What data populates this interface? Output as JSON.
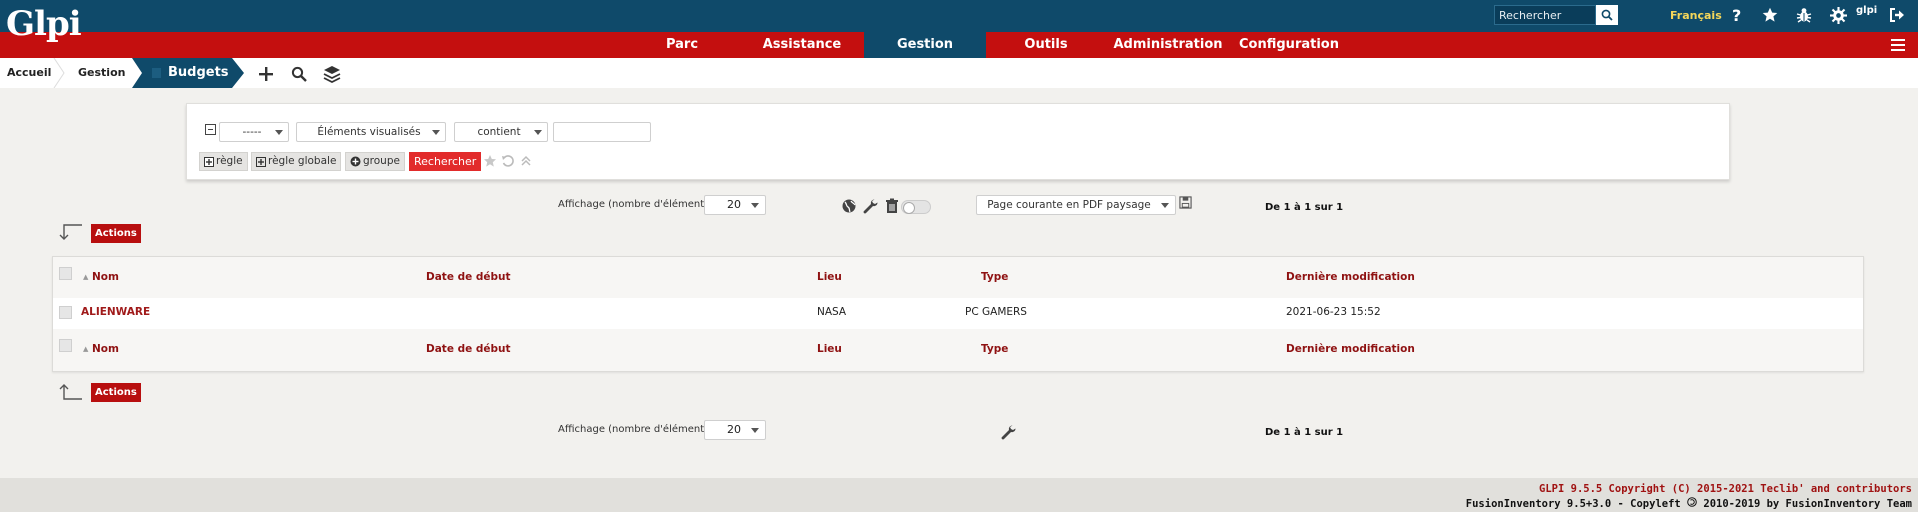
{
  "header": {
    "logo": "Glpi",
    "search_placeholder": "Rechercher",
    "language": "Français",
    "user": "glpi",
    "icons": [
      "help-icon",
      "star-icon",
      "bug-icon",
      "gear-icon",
      "logout-icon"
    ]
  },
  "menu": {
    "items": [
      "Parc",
      "Assistance",
      "Gestion",
      "Outils",
      "Administration",
      "Configuration"
    ],
    "active": "Gestion"
  },
  "breadcrumb": {
    "home": "Accueil",
    "section": "Gestion",
    "current": "Budgets",
    "tools": [
      "add-icon",
      "search-icon",
      "layers-icon"
    ]
  },
  "criteria": {
    "link_select": "-----",
    "field_select": "Éléments visualisés",
    "operator_select": "contient",
    "value": "",
    "buttons": {
      "rule": "règle",
      "global_rule": "règle globale",
      "group": "groupe",
      "search": "Rechercher"
    }
  },
  "display": {
    "label": "Affichage (nombre d'éléments)",
    "count": "20",
    "export_option": "Page courante en PDF paysage",
    "pager": "De 1 à 1 sur 1"
  },
  "actions_label": "Actions",
  "table": {
    "columns": [
      "Nom",
      "Date de début",
      "Lieu",
      "Type",
      "Dernière modification"
    ],
    "rows": [
      {
        "nom": "ALIENWARE",
        "date_debut": "",
        "lieu": "NASA",
        "type": "PC GAMERS",
        "modif": "2021-06-23 15:52"
      }
    ]
  },
  "footer": {
    "line1": "GLPI 9.5.5 Copyright (C) 2015-2021 Teclib' and contributors",
    "line2_prefix": "FusionInventory 9.5+3.0 - Copyleft",
    "line2_suffix": "2010-2019 by FusionInventory Team"
  },
  "colors": {
    "header_bg": "#0f4a6a",
    "menu_bg": "#c40f0f",
    "accent_red": "#e22b2b",
    "link_red": "#a01a1a",
    "language_yellow": "#f5d75a"
  }
}
